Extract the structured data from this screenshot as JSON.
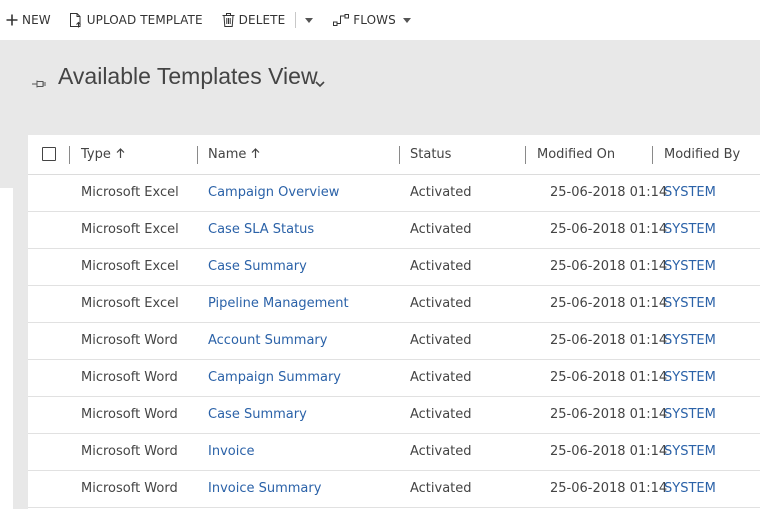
{
  "toolbar": {
    "new_label": "NEW",
    "upload_label": "UPLOAD TEMPLATE",
    "delete_label": "DELETE",
    "flows_label": "FLOWS"
  },
  "view": {
    "title": "Available Templates View"
  },
  "grid": {
    "columns": {
      "type": "Type",
      "name": "Name",
      "status": "Status",
      "modified_on": "Modified On",
      "modified_by": "Modified By"
    },
    "rows": [
      {
        "type": "Microsoft Excel",
        "name": "Campaign Overview",
        "status": "Activated",
        "modified_on": "25-06-2018 01:14",
        "modified_by": "SYSTEM"
      },
      {
        "type": "Microsoft Excel",
        "name": "Case SLA Status",
        "status": "Activated",
        "modified_on": "25-06-2018 01:14",
        "modified_by": "SYSTEM"
      },
      {
        "type": "Microsoft Excel",
        "name": "Case Summary",
        "status": "Activated",
        "modified_on": "25-06-2018 01:14",
        "modified_by": "SYSTEM"
      },
      {
        "type": "Microsoft Excel",
        "name": "Pipeline Management",
        "status": "Activated",
        "modified_on": "25-06-2018 01:14",
        "modified_by": "SYSTEM"
      },
      {
        "type": "Microsoft Word",
        "name": "Account Summary",
        "status": "Activated",
        "modified_on": "25-06-2018 01:14",
        "modified_by": "SYSTEM"
      },
      {
        "type": "Microsoft Word",
        "name": "Campaign Summary",
        "status": "Activated",
        "modified_on": "25-06-2018 01:14",
        "modified_by": "SYSTEM"
      },
      {
        "type": "Microsoft Word",
        "name": "Case Summary",
        "status": "Activated",
        "modified_on": "25-06-2018 01:14",
        "modified_by": "SYSTEM"
      },
      {
        "type": "Microsoft Word",
        "name": "Invoice",
        "status": "Activated",
        "modified_on": "25-06-2018 01:14",
        "modified_by": "SYSTEM"
      },
      {
        "type": "Microsoft Word",
        "name": "Invoice Summary",
        "status": "Activated",
        "modified_on": "25-06-2018 01:14",
        "modified_by": "SYSTEM"
      }
    ]
  },
  "colors": {
    "link": "#2b62a8",
    "header_band": "#e8e8e8",
    "text": "#444444"
  }
}
